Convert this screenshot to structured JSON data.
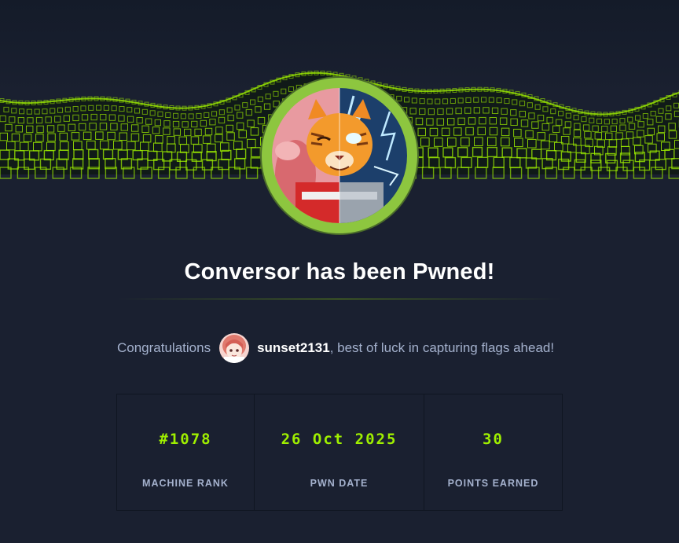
{
  "header": {
    "banner_icon": "green-wireframe-wave",
    "machine_avatar_icon": "cartoon-tiger-avatar"
  },
  "title": "Conversor has been Pwned!",
  "congrats": {
    "prefix": "Congratulations",
    "user_avatar_icon": "user-avatar",
    "username": "sunset2131",
    "suffix": ", best of luck in capturing flags ahead!"
  },
  "stats": [
    {
      "value": "#1078",
      "label": "MACHINE RANK"
    },
    {
      "value": "26 Oct 2025",
      "label": "PWN DATE"
    },
    {
      "value": "30",
      "label": "POINTS EARNED"
    }
  ],
  "colors": {
    "accent": "#9fef00",
    "background": "#1a2030",
    "ring": "#8dc63f"
  }
}
